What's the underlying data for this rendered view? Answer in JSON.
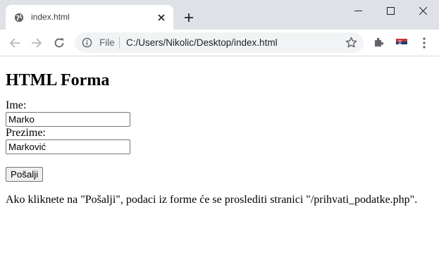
{
  "browser": {
    "tab_title": "index.html",
    "omnibox_scheme_label": "File",
    "url": "C:/Users/Nikolic/Desktop/index.html"
  },
  "page": {
    "heading": "HTML Forma",
    "fields": {
      "first_name_label": "Ime:",
      "first_name_value": "Marko",
      "last_name_label": "Prezime:",
      "last_name_value": "Marković"
    },
    "submit_label": "Pošalji",
    "note": "Ako kliknete na \"Pošalji\", podaci iz forme će se proslediti stranici \"/prihvati_podatke.php\"."
  }
}
